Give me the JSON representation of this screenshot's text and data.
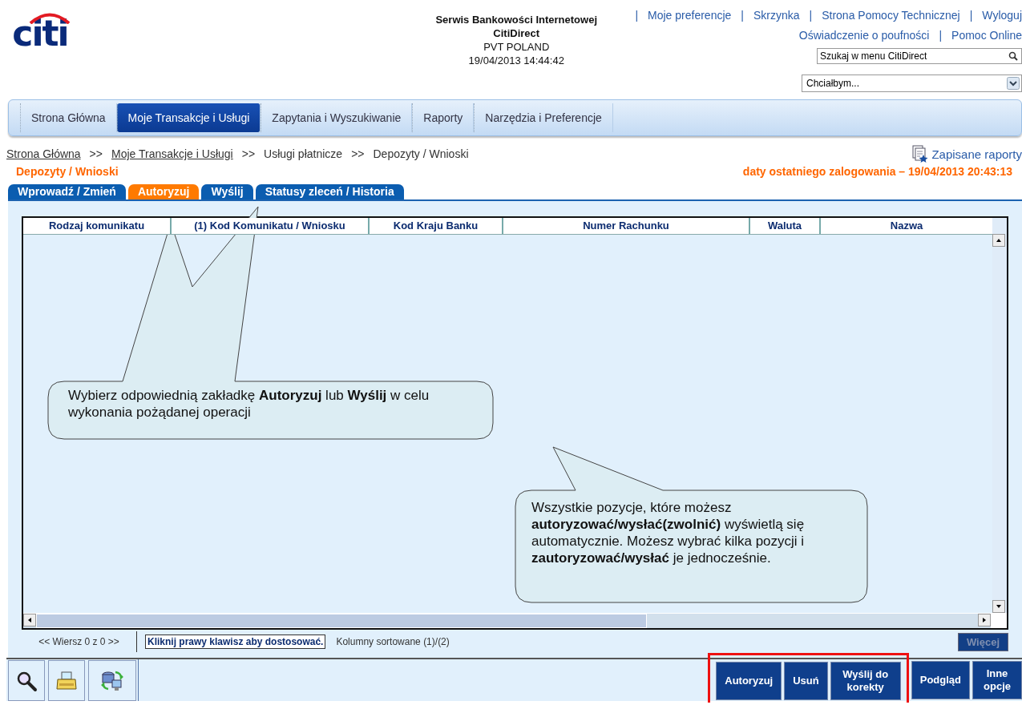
{
  "header": {
    "logo": "citi",
    "service_lines": [
      "Serwis Bankowości Internetowej",
      "CitiDirect",
      "PVT POLAND",
      "19/04/2013 14:44:42"
    ],
    "top_links": [
      {
        "label": "|",
        "kind": "separator"
      },
      {
        "label": "Moje preferencje",
        "kind": "link"
      },
      {
        "label": "|",
        "kind": "separator"
      },
      {
        "label": "Skrzynka",
        "kind": "link"
      },
      {
        "label": "|",
        "kind": "separator"
      },
      {
        "label": "Strona Pomocy Technicznej",
        "kind": "link"
      },
      {
        "label": "|",
        "kind": "separator"
      },
      {
        "label": "Wyloguj",
        "kind": "link"
      }
    ],
    "second_links": [
      {
        "label": "Oświadczenie o poufności",
        "kind": "link"
      },
      {
        "label": "|",
        "kind": "separator"
      },
      {
        "label": "Pomoc Online",
        "kind": "link"
      }
    ],
    "search": {
      "placeholder": "Szukaj w menu CitiDirect"
    },
    "dropdown": {
      "value": "Chciałbym..."
    }
  },
  "nav": [
    {
      "label": "Strona Główna",
      "selected": false
    },
    {
      "label": "Moje Transakcje i Usługi",
      "selected": true
    },
    {
      "label": "Zapytania i Wyszukiwanie",
      "selected": false
    },
    {
      "label": "Raporty",
      "selected": false
    },
    {
      "label": "Narzędzia i Preferencje",
      "selected": false
    }
  ],
  "breadcrumb": [
    {
      "label": "Strona Główna",
      "kind": "link"
    },
    {
      "label": ">>",
      "kind": "separator"
    },
    {
      "label": "Moje Transakcje i Usługi",
      "kind": "link"
    },
    {
      "label": ">>",
      "kind": "separator"
    },
    {
      "label": "Usługi płatnicze",
      "kind": "text"
    },
    {
      "label": ">>",
      "kind": "separator"
    },
    {
      "label": "Depozyty / Wnioski",
      "kind": "text"
    }
  ],
  "saved_reports": "Zapisane raporty",
  "page_title": "Depozyty / Wnioski",
  "last_login": "daty ostatniego zalogowania –  19/04/2013 20:43:13",
  "tabs": [
    {
      "label": "Wprowadź / Zmień",
      "selected": false
    },
    {
      "label": "Autoryzuj",
      "selected": true
    },
    {
      "label": "Wyślij",
      "selected": false
    },
    {
      "label": "Statusy zleceń / Historia",
      "selected": false
    }
  ],
  "table": {
    "columns": [
      "Rodzaj komunikatu",
      "(1) Kod Komunikatu / Wniosku",
      "Kod Kraju Banku",
      "Numer Rachunku",
      "Waluta",
      "Nazwa"
    ]
  },
  "footer": {
    "row_counter": "<< Wiersz 0 z 0 >>",
    "hint": "Kliknij prawy klawisz aby dostosować.",
    "sort_info": "Kolumny sortowane (1)/(2)",
    "more_button": {
      "label": "Więcej",
      "disabled": true
    }
  },
  "toolbar_icons": [
    {
      "kind": "search"
    },
    {
      "kind": "print"
    },
    {
      "kind": "transfer"
    }
  ],
  "action_groups": [
    {
      "highlighted": true,
      "buttons": [
        "Autoryzuj",
        "Usuń",
        "Wyślij do korekty"
      ]
    },
    {
      "highlighted": false,
      "buttons": [
        "Podgląd",
        "Inne opcje"
      ]
    }
  ],
  "callouts": [
    {
      "text": "Wybierz odpowiednią zakładkę **Autoryzuj** lub **Wyślij** w celu wykonania pożądanej operacji"
    },
    {
      "text": "Wszystkie pozycje, które możesz **autoryzować/wysłać(zwolnić)** wyświetlą się automatycznie. Możesz wybrać kilka pozycji i **zautoryzować/wysłać** je jednocześnie."
    }
  ]
}
